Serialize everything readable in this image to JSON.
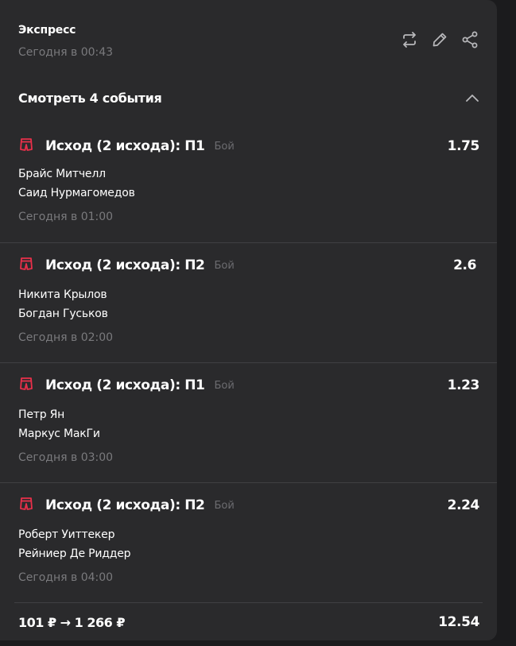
{
  "header": {
    "title": "Экспресс",
    "datetime": "Сегодня в 00:43",
    "icons": [
      "repeat-icon",
      "edit-icon",
      "share-icon"
    ]
  },
  "toggle": {
    "label": "Смотреть 4 события",
    "state": "expanded"
  },
  "events": [
    {
      "bet": "Исход (2 исхода): П1",
      "sport": "Бой",
      "odds": "1.75",
      "team1": "Брайс Митчелл",
      "team2": "Саид Нурмагомедов",
      "time": "Сегодня в 01:00"
    },
    {
      "bet": "Исход (2 исхода): П2",
      "sport": "Бой",
      "odds": "2.6",
      "team1": "Никита Крылов",
      "team2": "Богдан Гуськов",
      "time": "Сегодня в 02:00"
    },
    {
      "bet": "Исход (2 исхода): П1",
      "sport": "Бой",
      "odds": "1.23",
      "team1": "Петр Ян",
      "team2": "Маркус МакГи",
      "time": "Сегодня в 03:00"
    },
    {
      "bet": "Исход (2 исхода): П2",
      "sport": "Бой",
      "odds": "2.24",
      "team1": "Роберт Уиттекер",
      "team2": "Рейниер Де Риддер",
      "time": "Сегодня в 04:00"
    }
  ],
  "footer": {
    "sum": "101 ₽ → 1 266 ₽",
    "total_odds": "12.54"
  },
  "colors": {
    "background": "#2a2a2c",
    "accent": "#e8304a",
    "muted": "#7a7a7d"
  }
}
